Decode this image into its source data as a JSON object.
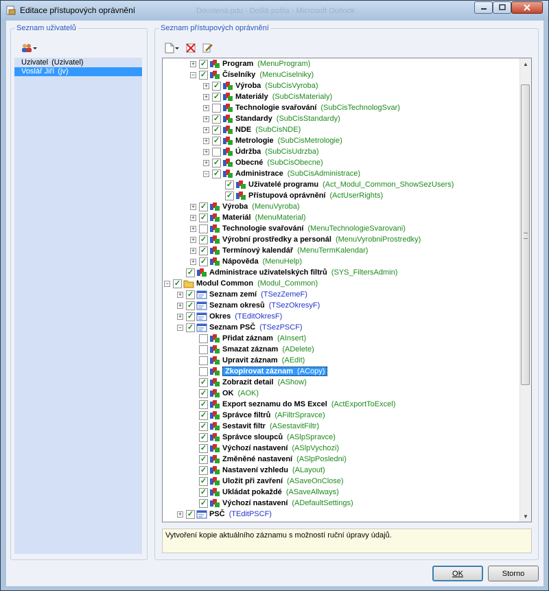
{
  "window": {
    "title": "Editace přístupových oprávnění",
    "background_title": "Dovolená.pdu - Došlá pošta - Microsoft Outlook"
  },
  "users_panel": {
    "label": "Seznam uživatelů",
    "users": [
      {
        "name": "Uzivatel",
        "code": "(Uzivatel)",
        "selected": false
      },
      {
        "name": "Voslář Jiří",
        "code": "(jv)",
        "selected": true
      }
    ]
  },
  "permissions_panel": {
    "label": "Seznam přístupových oprávnění",
    "tree": [
      {
        "label": "Program",
        "code": "(MenuProgram)",
        "exp": "+",
        "checked": true,
        "selected": false
      },
      {
        "label": "Číselníky",
        "code": "(MenuCiselniky)",
        "exp": "-",
        "checked": true,
        "selected": false
      },
      {
        "label": "Výroba",
        "code": "(SubCisVyroba)",
        "exp": "+",
        "checked": true,
        "selected": false
      },
      {
        "label": "Materiály",
        "code": "(SubCisMaterialy)",
        "exp": "+",
        "checked": true,
        "selected": false
      },
      {
        "label": "Technologie svařování",
        "code": "(SubCisTechnologSvar)",
        "exp": "+",
        "checked": false,
        "selected": false
      },
      {
        "label": "Standardy",
        "code": "(SubCisStandardy)",
        "exp": "+",
        "checked": true,
        "selected": false
      },
      {
        "label": "NDE",
        "code": "(SubCisNDE)",
        "exp": "+",
        "checked": true,
        "selected": false
      },
      {
        "label": "Metrologie",
        "code": "(SubCisMetrologie)",
        "exp": "+",
        "checked": true,
        "selected": false
      },
      {
        "label": "Údržba",
        "code": "(SubCisUdrzba)",
        "exp": "+",
        "checked": false,
        "selected": false
      },
      {
        "label": "Obecné",
        "code": "(SubCisObecne)",
        "exp": "+",
        "checked": true,
        "selected": false
      },
      {
        "label": "Administrace",
        "code": "(SubCisAdministrace)",
        "exp": "-",
        "checked": true,
        "selected": false
      },
      {
        "label": "Uživatelé programu",
        "code": "(Act_Modul_Common_ShowSezUsers)",
        "exp": "",
        "checked": true,
        "selected": false
      },
      {
        "label": "Přístupová oprávnění",
        "code": "(ActUserRights)",
        "exp": "",
        "checked": true,
        "selected": false
      },
      {
        "label": "Výroba",
        "code": "(MenuVyroba)",
        "exp": "+",
        "checked": true,
        "selected": false
      },
      {
        "label": "Materiál",
        "code": "(MenuMaterial)",
        "exp": "+",
        "checked": true,
        "selected": false
      },
      {
        "label": "Technologie svařování",
        "code": "(MenuTechnologieSvarovani)",
        "exp": "+",
        "checked": false,
        "selected": false
      },
      {
        "label": "Výrobní prostředky a personál",
        "code": "(MenuVyrobniProstredky)",
        "exp": "+",
        "checked": true,
        "selected": false
      },
      {
        "label": "Termínový kalendář",
        "code": "(MenuTermKalendar)",
        "exp": "+",
        "checked": true,
        "selected": false
      },
      {
        "label": "Nápověda",
        "code": "(MenuHelp)",
        "exp": "+",
        "checked": true,
        "selected": false
      },
      {
        "label": "Administrace uživatelských filtrů",
        "code": "(SYS_FiltersAdmin)",
        "exp": "",
        "checked": true,
        "selected": false
      },
      {
        "label": "Modul Common",
        "code": "(Modul_Common)",
        "exp": "-",
        "checked": true,
        "selected": false
      },
      {
        "label": "Seznam zemí",
        "code": "(TSezZemeF)",
        "exp": "+",
        "checked": true,
        "selected": false
      },
      {
        "label": "Seznam okresů",
        "code": "(TSezOkresyF)",
        "exp": "+",
        "checked": true,
        "selected": false
      },
      {
        "label": "Okres",
        "code": "(TEditOkresF)",
        "exp": "+",
        "checked": true,
        "selected": false
      },
      {
        "label": "Seznam PSČ",
        "code": "(TSezPSCF)",
        "exp": "-",
        "checked": true,
        "selected": false
      },
      {
        "label": "Přidat záznam",
        "code": "(AInsert)",
        "exp": "",
        "checked": false,
        "selected": false
      },
      {
        "label": "Smazat záznam",
        "code": "(ADelete)",
        "exp": "",
        "checked": false,
        "selected": false
      },
      {
        "label": "Upravit záznam",
        "code": "(AEdit)",
        "exp": "",
        "checked": false,
        "selected": false
      },
      {
        "label": "Zkopírovat záznam",
        "code": "(ACopy)",
        "exp": "",
        "checked": false,
        "selected": true
      },
      {
        "label": "Zobrazit detail",
        "code": "(AShow)",
        "exp": "",
        "checked": true,
        "selected": false
      },
      {
        "label": "OK",
        "code": "(AOK)",
        "exp": "",
        "checked": true,
        "selected": false
      },
      {
        "label": "Export seznamu do MS Excel",
        "code": "(ActExportToExcel)",
        "exp": "",
        "checked": true,
        "selected": false
      },
      {
        "label": "Správce filtrů",
        "code": "(AFiltrSpravce)",
        "exp": "",
        "checked": true,
        "selected": false
      },
      {
        "label": "Sestavit filtr",
        "code": "(ASestavitFiltr)",
        "exp": "",
        "checked": true,
        "selected": false
      },
      {
        "label": "Správce sloupců",
        "code": "(ASlpSpravce)",
        "exp": "",
        "checked": true,
        "selected": false
      },
      {
        "label": "Výchozí nastavení",
        "code": "(ASlpVychozi)",
        "exp": "",
        "checked": true,
        "selected": false
      },
      {
        "label": "Změněné nastavení",
        "code": "(ASlpPosledni)",
        "exp": "",
        "checked": true,
        "selected": false
      },
      {
        "label": "Nastavení vzhledu",
        "code": "(ALayout)",
        "exp": "",
        "checked": true,
        "selected": false
      },
      {
        "label": "Uložit při zavření",
        "code": "(ASaveOnClose)",
        "exp": "",
        "checked": true,
        "selected": false
      },
      {
        "label": "Ukládat pokaždé",
        "code": "(ASaveAllways)",
        "exp": "",
        "checked": true,
        "selected": false
      },
      {
        "label": "Výchozí nastavení",
        "code": "(ADefaultSettings)",
        "exp": "",
        "checked": true,
        "selected": false
      },
      {
        "label": "PSČ",
        "code": "(TEditPSCF)",
        "exp": "+",
        "checked": true,
        "selected": false
      }
    ],
    "description": "Vytvoření kopie aktuálního záznamu s možností ruční úpravy údajů."
  },
  "buttons": {
    "ok": "OK",
    "cancel": "Storno"
  },
  "colors": {
    "accent": "#3399ff",
    "code_green": "#1b8a1b",
    "code_blue": "#2233cc",
    "group_label": "#2a58b8"
  }
}
